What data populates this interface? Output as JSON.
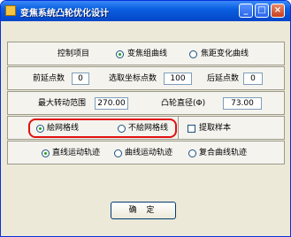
{
  "window": {
    "title": "变焦系统凸轮优化设计"
  },
  "project": {
    "label": "控制项目",
    "options": [
      "变焦组曲线",
      "焦距变化曲线"
    ],
    "selected": 0
  },
  "points": {
    "pre_label": "前延点数",
    "pre_value": "0",
    "select_label": "选取坐标点数",
    "select_value": "100",
    "post_label": "后延点数",
    "post_value": "0"
  },
  "ranges": {
    "rotation_label": "最大转动范围",
    "rotation_value": "270.00",
    "cam_label": "凸轮直径(Φ)",
    "cam_value": "73.00"
  },
  "grid": {
    "options": [
      "絵网格线",
      "不絵网格线"
    ],
    "selected": 0,
    "sample_label": "提取样本",
    "sample_checked": false
  },
  "trajectory": {
    "options": [
      "直线运动轨迹",
      "曲线运动轨迹",
      "复合曲线轨迹"
    ],
    "selected": 0
  },
  "buttons": {
    "ok": "确 定"
  },
  "colors": {
    "title_bar": "#0a5fe0",
    "highlight": "#e01010",
    "dialog": "#ece9d8"
  }
}
